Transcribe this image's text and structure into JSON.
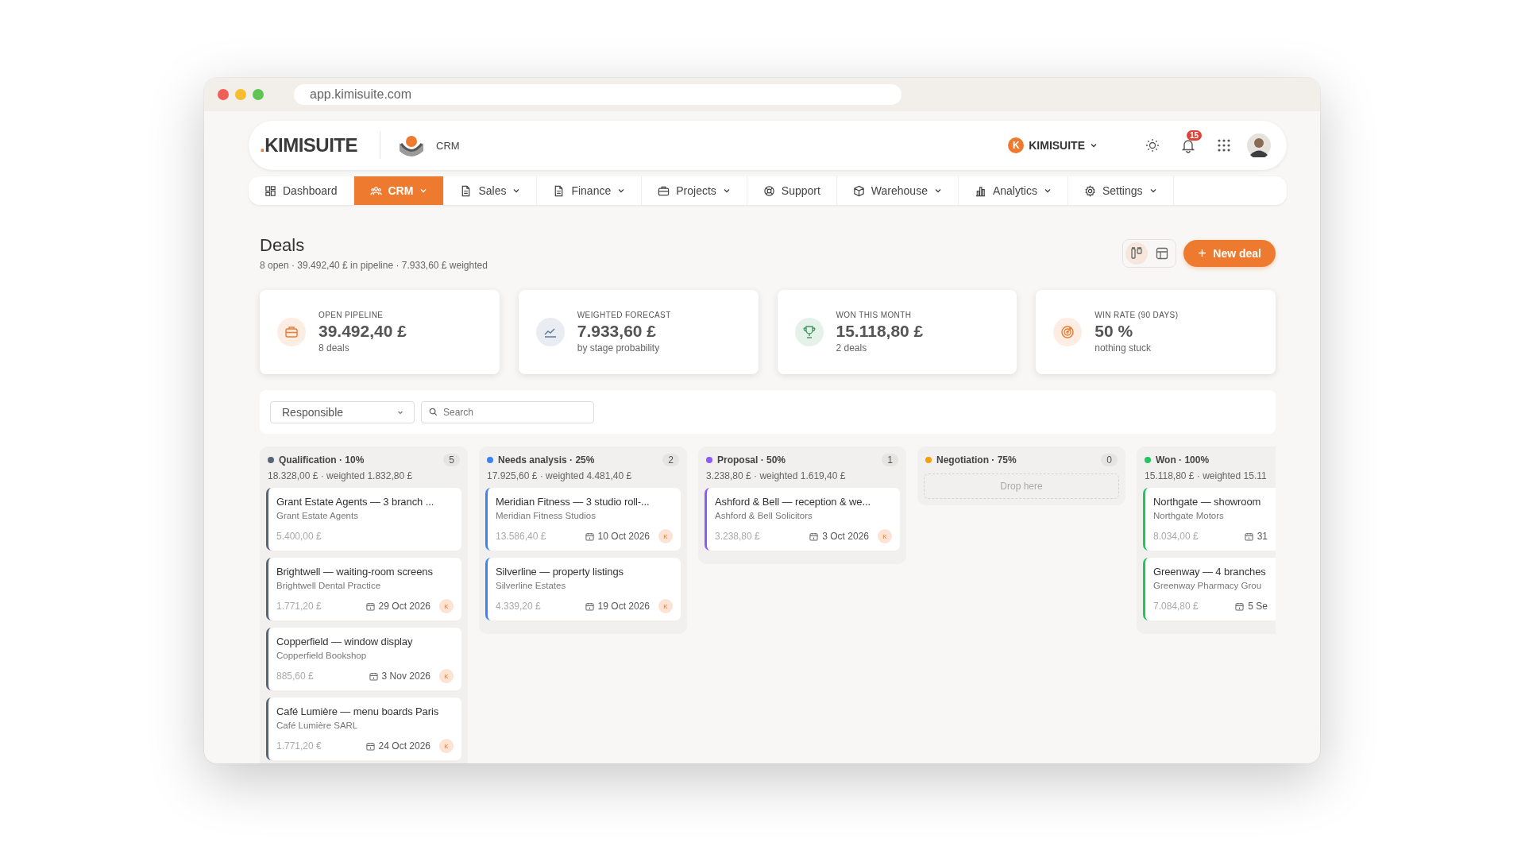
{
  "browser": {
    "url": "app.kimisuite.com"
  },
  "header": {
    "logo_mark": ".",
    "logo_name": "KIMISUITE",
    "module": "CRM",
    "workspace_initial": "K",
    "workspace_name": "KIMISUITE",
    "notifications": "15"
  },
  "nav": [
    {
      "label": "Dashboard",
      "selected": false,
      "has_menu": false
    },
    {
      "label": "CRM",
      "selected": true,
      "has_menu": true
    },
    {
      "label": "Sales",
      "selected": false,
      "has_menu": true
    },
    {
      "label": "Finance",
      "selected": false,
      "has_menu": true
    },
    {
      "label": "Projects",
      "selected": false,
      "has_menu": true
    },
    {
      "label": "Support",
      "selected": false,
      "has_menu": false
    },
    {
      "label": "Warehouse",
      "selected": false,
      "has_menu": true
    },
    {
      "label": "Analytics",
      "selected": false,
      "has_menu": true
    },
    {
      "label": "Settings",
      "selected": false,
      "has_menu": true
    }
  ],
  "page": {
    "title": "Deals",
    "summary": "8 open · 39.492,40 £ in pipeline · 7.933,60 £ weighted"
  },
  "view_toggle": [
    {
      "kind": "board",
      "selected": true
    },
    {
      "kind": "table",
      "selected": false
    }
  ],
  "new_button": {
    "label": "New deal"
  },
  "kpis": [
    {
      "label": "OPEN PIPELINE",
      "value": "39.492,40 £",
      "sub": "8 deals",
      "color": "#ee7a30"
    },
    {
      "label": "WEIGHTED FORECAST",
      "value": "7.933,60 £",
      "sub": "by stage probability",
      "color": "#5b7a99"
    },
    {
      "label": "WON THIS MONTH",
      "value": "15.118,80 £",
      "sub": "2 deals",
      "color": "#3f9a5c"
    },
    {
      "label": "WIN RATE (90 DAYS)",
      "value": "50 %",
      "sub": "nothing stuck",
      "color": "#ee7a30"
    }
  ],
  "filters": {
    "responsible": "Responsible",
    "search_placeholder": "Search"
  },
  "columns": [
    {
      "name": "Qualification · 10%",
      "color": "#56657a",
      "count": "5",
      "summary": "18.328,00 £ · weighted 1.832,80 £",
      "deals": [
        {
          "title": "Grant Estate Agents — 3 branch ...",
          "company": "Grant Estate Agents",
          "amount": "5.400,00 £"
        },
        {
          "title": "Brightwell — waiting-room screens",
          "company": "Brightwell Dental Practice",
          "amount": "1.771,20 £",
          "date": "29 Oct 2026",
          "owner": "K"
        },
        {
          "title": "Copperfield — window display",
          "company": "Copperfield Bookshop",
          "amount": "885,60 £",
          "date": "3 Nov 2026",
          "owner": "K"
        },
        {
          "title": "Café Lumière — menu boards Paris",
          "company": "Café Lumière SARL",
          "amount": "1.771,20 €",
          "date": "24 Oct 2026",
          "owner": "K"
        }
      ]
    },
    {
      "name": "Needs analysis · 25%",
      "color": "#3b82f6",
      "count": "2",
      "summary": "17.925,60 £ · weighted 4.481,40 £",
      "deals": [
        {
          "title": "Meridian Fitness — 3 studio roll-...",
          "company": "Meridian Fitness Studios",
          "amount": "13.586,40 £",
          "date": "10 Oct 2026",
          "owner": "K"
        },
        {
          "title": "Silverline — property listings",
          "company": "Silverline Estates",
          "amount": "4.339,20 £",
          "date": "19 Oct 2026",
          "owner": "K"
        }
      ]
    },
    {
      "name": "Proposal · 50%",
      "color": "#8b5cf6",
      "count": "1",
      "summary": "3.238,80 £ · weighted 1.619,40 £",
      "deals": [
        {
          "title": "Ashford & Bell — reception & we...",
          "company": "Ashford & Bell Solicitors",
          "amount": "3.238,80 £",
          "date": "3 Oct 2026",
          "owner": "K"
        }
      ]
    },
    {
      "name": "Negotiation · 75%",
      "color": "#f59e0b",
      "count": "0",
      "drop_hint": "Drop here"
    },
    {
      "name": "Won · 100%",
      "color": "#22c55e",
      "summary": "15.118,80 £ · weighted 15.11",
      "deals": [
        {
          "title": "Northgate — showroom",
          "company": "Northgate Motors",
          "amount": "8.034,00 £",
          "date": "31"
        },
        {
          "title": "Greenway — 4 branches",
          "company": "Greenway Pharmacy Grou",
          "amount": "7.084,80 £",
          "date": "5 Se"
        }
      ]
    }
  ]
}
